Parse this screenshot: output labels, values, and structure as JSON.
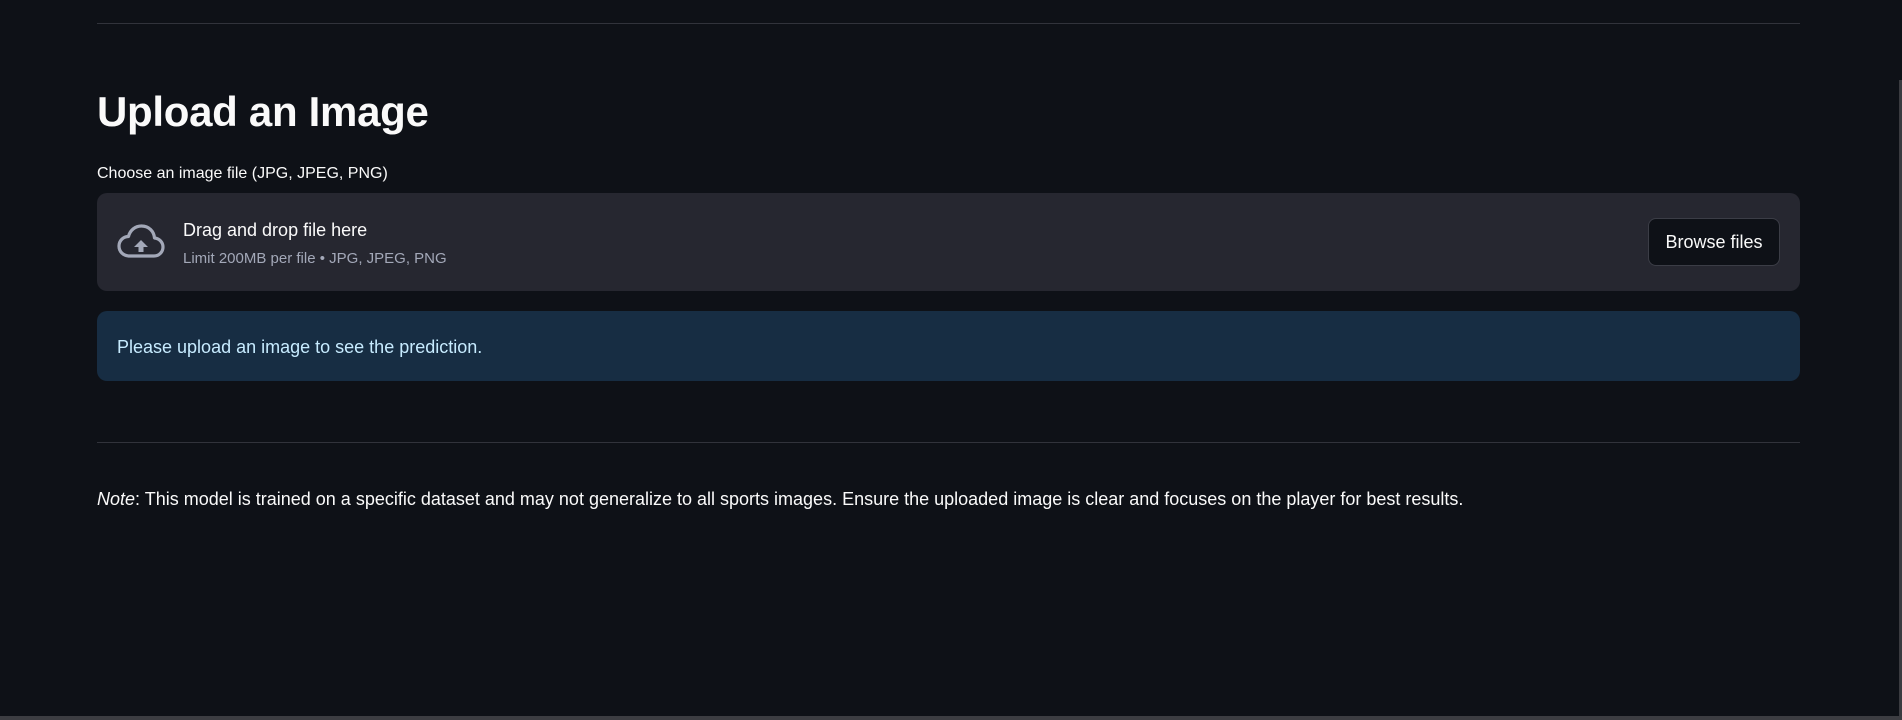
{
  "upload_section": {
    "heading": "Upload an Image",
    "field_label": "Choose an image file (JPG, JPEG, PNG)",
    "dropzone": {
      "icon": "cloud-upload-icon",
      "title": "Drag and drop file here",
      "subtitle": "Limit 200MB per file • JPG, JPEG, PNG",
      "browse_label": "Browse files"
    },
    "info_message": "Please upload an image to see the prediction."
  },
  "note": {
    "prefix": "Note",
    "text": ": This model is trained on a specific dataset and may not generalize to all sports images. Ensure the uploaded image is clear and focuses on the player for best results."
  },
  "colors": {
    "background": "#0e1117",
    "dropzone_bg": "#262730",
    "info_bg": "#172d43",
    "info_text": "#c7ebff"
  }
}
